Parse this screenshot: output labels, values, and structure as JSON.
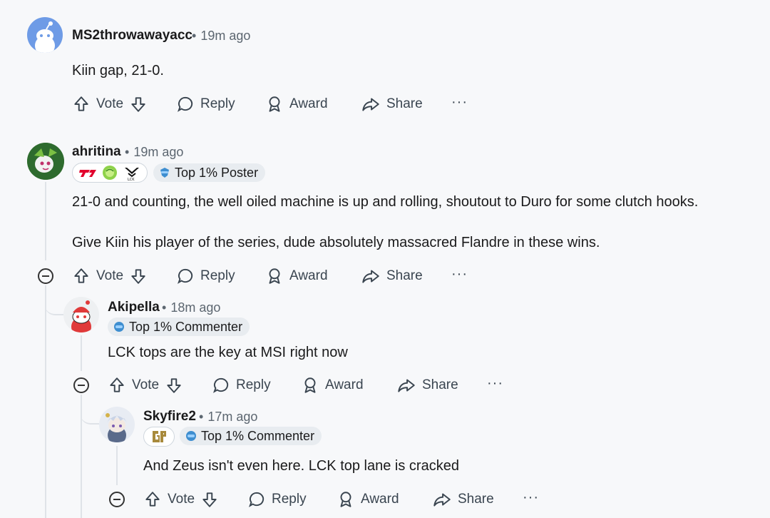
{
  "actions": {
    "vote": "Vote",
    "reply": "Reply",
    "award": "Award",
    "share": "Share",
    "more": "···"
  },
  "comments": [
    {
      "author": "MS2throwawayacc",
      "time": "19m ago",
      "body": [
        "Kiin gap, 21-0."
      ]
    },
    {
      "author": "ahritina",
      "time": "19m ago",
      "flair": "Top 1% Poster",
      "team_flairs": [
        "T1",
        "green-badge",
        "LCK"
      ],
      "body": [
        "21-0 and counting, the well oiled machine is up and rolling, shoutout to Duro for some clutch hooks.",
        "Give Kiin his player of the series, dude absolutely massacred Flandre in these wins."
      ]
    },
    {
      "author": "Akipella",
      "time": "18m ago",
      "flair": "Top 1% Commenter",
      "body": [
        "LCK tops are the key at MSI right now"
      ]
    },
    {
      "author": "Skyfire2",
      "time": "17m ago",
      "flair": "Top 1% Commenter",
      "team_flairs": [
        "Gen.G"
      ],
      "body": [
        "And Zeus isn't even here. LCK top lane is cracked"
      ]
    }
  ],
  "colors": {
    "background": "#f7f8fa",
    "thread_line": "#dfe3e8",
    "flair_bg": "#e8ecf0",
    "text": "#1a1a1b",
    "meta": "#5c6670"
  }
}
